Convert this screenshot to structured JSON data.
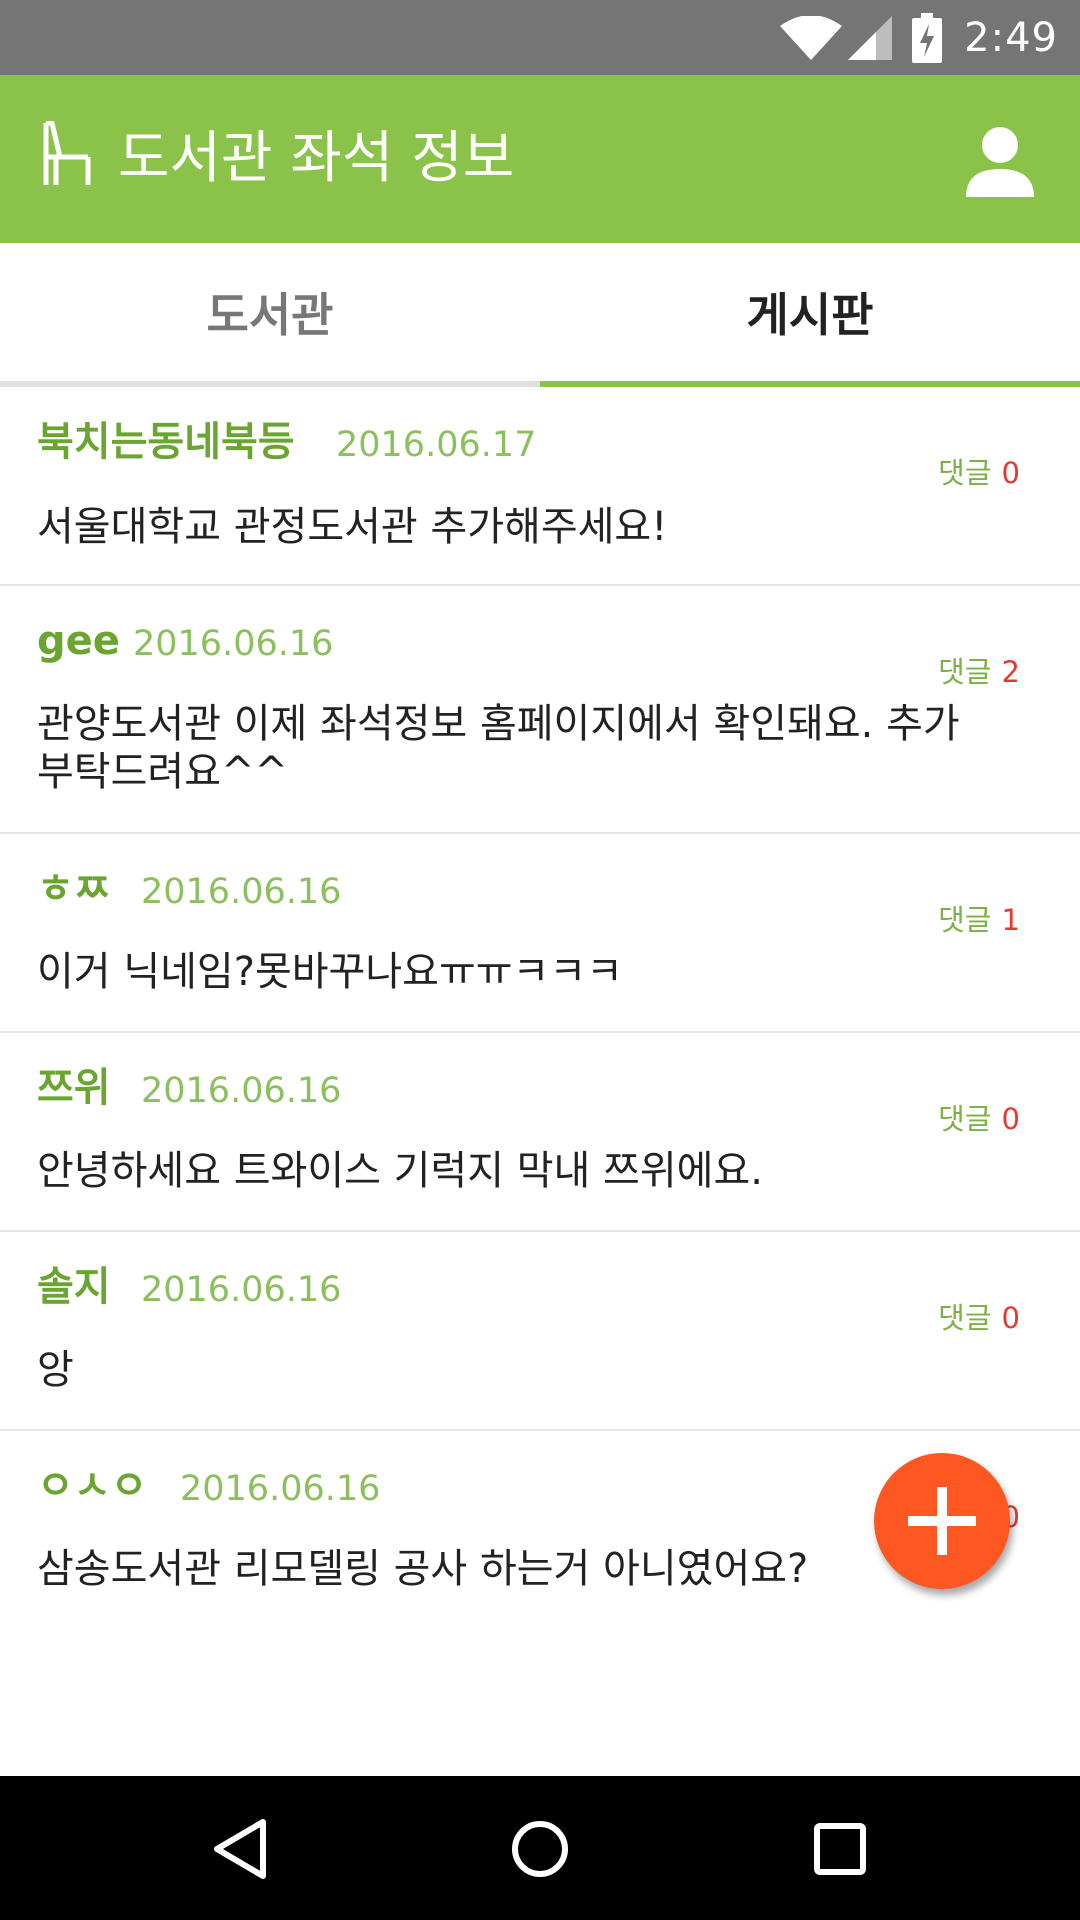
{
  "status_bar": {
    "time": "2:49",
    "icons": [
      "wifi-icon",
      "cell-signal-icon",
      "battery-charging-icon"
    ]
  },
  "app_bar": {
    "title": "도서관 좌석 정보",
    "logo_icon": "chair-icon",
    "action_icon": "person-icon",
    "color": "#8bc34a"
  },
  "tabs": [
    {
      "label": "도서관",
      "selected": false
    },
    {
      "label": "게시판",
      "selected": true
    }
  ],
  "comment_label": "댓글",
  "posts": [
    {
      "author": "북치는동네북등",
      "date": "2016.06.17",
      "comments": "0",
      "body": "서울대학교 관정도서관 추가해주세요!"
    },
    {
      "author": "gee",
      "date": "2016.06.16",
      "comments": "2",
      "body": "관양도서관 이제 좌석정보 홈페이지에서 확인돼요. 추가부탁드려요^^"
    },
    {
      "author": "ㅎㅉ",
      "date": "2016.06.16",
      "comments": "1",
      "body": "이거 닉네임?못바꾸나요ㅠㅠㅋㅋㅋ"
    },
    {
      "author": "쯔위",
      "date": "2016.06.16",
      "comments": "0",
      "body": "안녕하세요 트와이스 기럭지 막내 쯔위에요."
    },
    {
      "author": "솔지",
      "date": "2016.06.16",
      "comments": "0",
      "body": "앙"
    },
    {
      "author": "ㅇㅅㅇ",
      "date": "2016.06.16",
      "comments": "0",
      "body": "삼송도서관 리모델링 공사 하는거 아니였어요?"
    }
  ],
  "fab": {
    "icon": "plus-icon",
    "color": "#ff5722"
  },
  "nav_bar": {
    "icons": [
      "back-icon",
      "home-icon",
      "recents-icon"
    ]
  },
  "colors": {
    "accent": "#8bc34a",
    "author": "#6aa532",
    "comment_count": "#e53935"
  }
}
